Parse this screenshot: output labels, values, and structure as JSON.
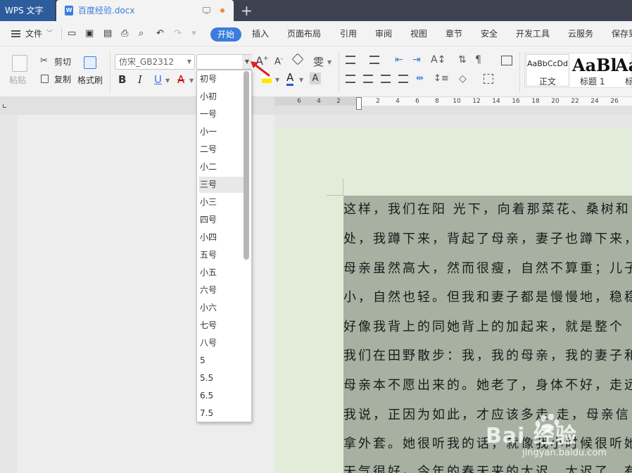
{
  "titlebar": {
    "app_name": "WPS 文字",
    "doc_name": "百度经验.docx",
    "doc_icon": "W",
    "new_tab": "+"
  },
  "menu": {
    "file": "文件",
    "items": [
      "开始",
      "插入",
      "页面布局",
      "引用",
      "审阅",
      "视图",
      "章节",
      "安全",
      "开发工具",
      "云服务",
      "保存到"
    ]
  },
  "ribbon": {
    "paste": "粘贴",
    "cut": "剪切",
    "copy": "复制",
    "format_painter": "格式刷",
    "font_name": "仿宋_GB2312",
    "font_size": "",
    "bold": "B",
    "italic": "I",
    "underline": "U",
    "strike": "A",
    "styles": [
      {
        "sample": "AaBbCcDd",
        "name": "正文"
      },
      {
        "sample": "AaBl",
        "name": "标题 1"
      },
      {
        "sample": "Aa",
        "name": "标"
      }
    ]
  },
  "ruler": {
    "ticks": [
      "6",
      "4",
      "2",
      "2",
      "4",
      "6",
      "8",
      "10",
      "12",
      "14",
      "16",
      "18",
      "20",
      "22",
      "24",
      "26"
    ]
  },
  "font_size_dropdown": {
    "options": [
      "初号",
      "小初",
      "一号",
      "小一",
      "二号",
      "小二",
      "三号",
      "小三",
      "四号",
      "小四",
      "五号",
      "小五",
      "六号",
      "小六",
      "七号",
      "八号",
      "5",
      "5.5",
      "6.5",
      "7.5"
    ],
    "highlighted": "三号"
  },
  "document": {
    "lines": [
      "这样，我们在阳 光下，向着那菜花、桑树和",
      "处，我蹲下来，背起了母亲，妻子也蹲下来，",
      "母亲虽然高大，然而很瘦，自然不算重；儿子",
      "小，自然也轻。但我和妻子都是慢慢地，稳稳",
      "好像我背上的同她背上的加起来，就是整个",
      "我们在田野散步：我，我的母亲，我的妻子和",
      "母亲本不愿出来的。她老了，身体不好，走远",
      "我说，正因为如此，才应该多走 走，母亲信",
      "拿外套。她很听我的话，就像我小时候很听她",
      "天气很好。今年的春天来的太迟，太迟了，有"
    ]
  },
  "watermark": {
    "brand": "Bai 经验",
    "url": "jingyan.baidu.com"
  },
  "colors": {
    "accent": "#3b7ddd",
    "titlebar": "#3c4250",
    "page_bg": "#e1ecd9",
    "selection": "#a6b1a2",
    "arrow": "#e0201b"
  }
}
